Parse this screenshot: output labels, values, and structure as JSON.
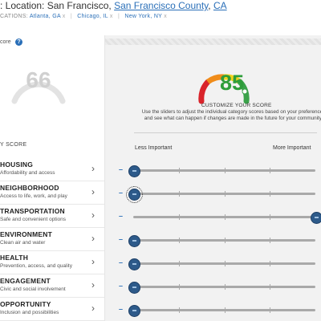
{
  "header": {
    "location_prefix": ": Location:",
    "city": "San Francisco,",
    "county": "San Francisco County",
    "state": "CA",
    "previous_locations_label": "CATIONS:",
    "previous_locations": [
      "Atlanta, GA",
      "Chicago, IL",
      "New York, NY"
    ],
    "remove_glyph": "x"
  },
  "left_panel": {
    "score_label": "core",
    "help_glyph": "?",
    "score": "66",
    "by_score_label": "Y SCORE",
    "chevron_glyph": "›",
    "categories": [
      {
        "name": "HOUSING",
        "desc": "Affordability and access"
      },
      {
        "name": "NEIGHBORHOOD",
        "desc": "Access to life, work, and play"
      },
      {
        "name": "TRANSPORTATION",
        "desc": "Safe and convenient options"
      },
      {
        "name": "ENVIRONMENT",
        "desc": "Clean air and water"
      },
      {
        "name": "HEALTH",
        "desc": "Prevention, access, and quality"
      },
      {
        "name": "ENGAGEMENT",
        "desc": "Civic and social involvement"
      },
      {
        "name": "OPPORTUNITY",
        "desc": "Inclusion and possibilities"
      }
    ]
  },
  "right_panel": {
    "score": "85",
    "customize_title": "CUSTOMIZE YOUR SCORE",
    "customize_desc": "Use the sliders to adjust the individual category scores based on your preferences and see what can happen if changes are made in the future for your community.",
    "less_label": "Less Important",
    "more_label": "More Important",
    "minus_glyph": "–",
    "slider_levels": [
      0,
      0,
      1,
      0,
      0,
      0,
      0
    ]
  },
  "colors": {
    "accent": "#2a6fb8",
    "score_green": "#2e9d3a",
    "thumb": "#2d5a8a"
  }
}
